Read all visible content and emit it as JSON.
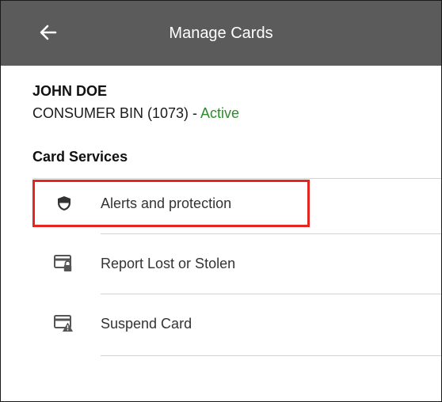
{
  "header": {
    "title": "Manage Cards",
    "back_icon": "arrow-left-icon",
    "background": "#5b5b5b"
  },
  "account": {
    "name": "JOHN DOE",
    "card_label": "CONSUMER BIN (1073) - ",
    "status": "Active",
    "status_color": "#2e8b2e"
  },
  "card_services": {
    "heading": "Card Services",
    "items": [
      {
        "label": "Alerts and protection",
        "icon": "shield-icon",
        "highlighted": true
      },
      {
        "label": "Report Lost or Stolen",
        "icon": "card-lock-icon"
      },
      {
        "label": "Suspend Card",
        "icon": "card-warning-icon"
      }
    ]
  },
  "highlight_color": "#e3261f"
}
